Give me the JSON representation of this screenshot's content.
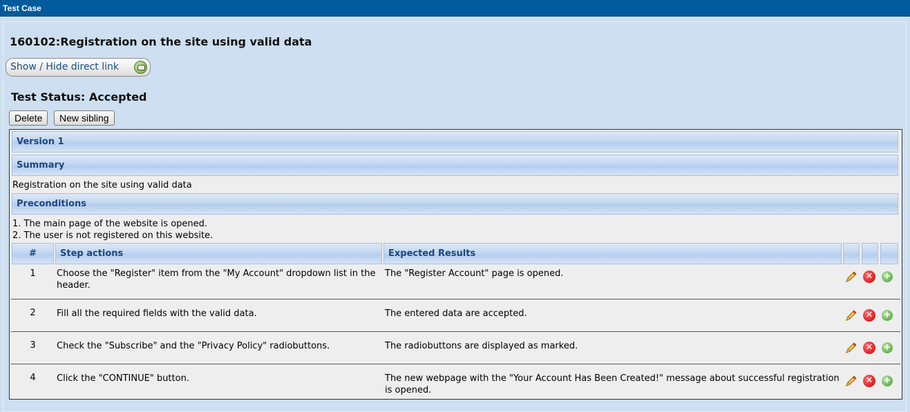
{
  "window": {
    "title": "Test Case"
  },
  "testcase": {
    "title": "160102:Registration on the site using valid data",
    "direct_link_label": "Show / Hide direct link",
    "status": "Test Status: Accepted"
  },
  "buttons": {
    "delete": "Delete",
    "new_sibling": "New sibling"
  },
  "version": {
    "label": "Version 1"
  },
  "summary": {
    "heading": "Summary",
    "text": "Registration on the site using valid data"
  },
  "preconditions": {
    "heading": "Preconditions",
    "lines": [
      "1. The main page of the website is opened.",
      "2. The user is not registered on this website."
    ]
  },
  "steps_table": {
    "headers": {
      "num": "#",
      "actions": "Step actions",
      "expected": "Expected Results"
    },
    "rows": [
      {
        "num": "1",
        "action": "Choose the \"Register\" item from the \"My Account\" dropdown list in the header.",
        "expected": "The \"Register Account\" page is opened."
      },
      {
        "num": "2",
        "action": "Fill all the required fields with the valid data.",
        "expected": "The entered data are accepted."
      },
      {
        "num": "3",
        "action": "Check the \"Subscribe\" and the \"Privacy Policy\" radiobuttons.",
        "expected": "The radiobuttons are displayed as marked."
      },
      {
        "num": "4",
        "action": "Click the \"CONTINUE\" button.",
        "expected": "The new webpage with the \"Your Account Has Been Created!\" message about successful registration is opened."
      }
    ],
    "row_icons": [
      "pencil-icon",
      "delete-icon",
      "add-icon"
    ]
  },
  "colors": {
    "topbar": "#005a9c",
    "background": "#cddff0",
    "header_text": "#1c4680"
  }
}
